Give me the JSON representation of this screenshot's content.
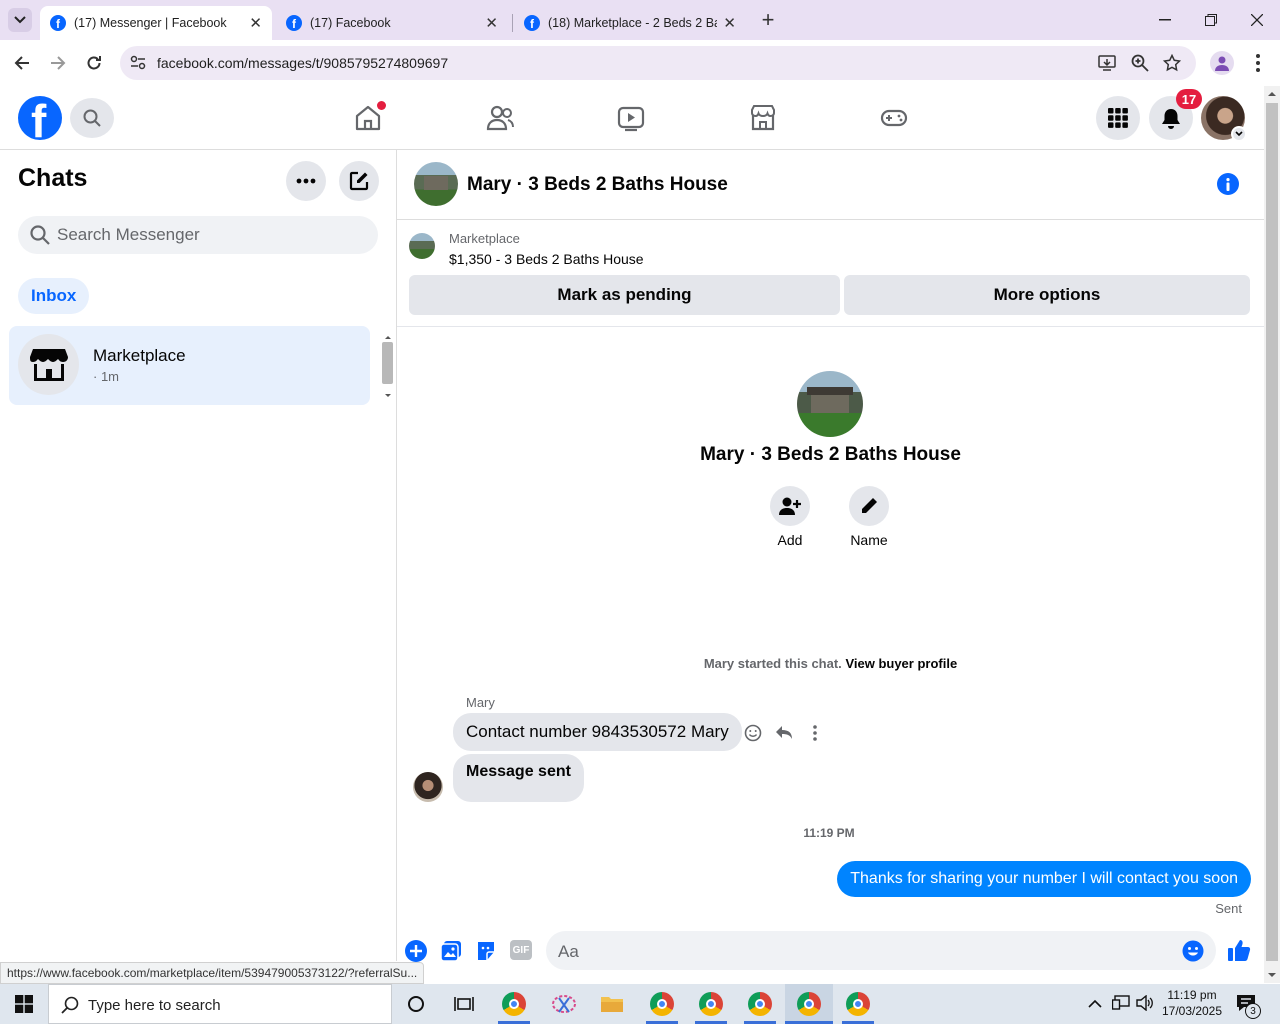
{
  "browser": {
    "tabs": [
      {
        "title": "(17) Messenger | Facebook",
        "active": true
      },
      {
        "title": "(17) Facebook",
        "active": false
      },
      {
        "title": "(18) Marketplace - 2 Beds 2 Bat",
        "active": false
      }
    ],
    "new_tab_label": "+",
    "url": "facebook.com/messages/t/9085795274809697",
    "status_url": "https://www.facebook.com/marketplace/item/539479005373122/?referralSu..."
  },
  "header": {
    "notifications_count": "17",
    "logo_letter": "f"
  },
  "sidebar": {
    "title": "Chats",
    "search_placeholder": "Search Messenger",
    "filter_tab": "Inbox",
    "conversations": [
      {
        "name": "Marketplace",
        "meta": "· 1m"
      }
    ]
  },
  "chat": {
    "title": "Mary · 3 Beds 2 Baths House",
    "listing": {
      "source": "Marketplace",
      "price_title": "$1,350 - 3 Beds 2 Baths House"
    },
    "mark_pending_label": "Mark as pending",
    "more_options_label": "More options",
    "intro_title": "Mary · 3 Beds 2 Baths House",
    "add_label": "Add",
    "name_label": "Name",
    "started_text": "Mary started this chat.",
    "view_profile_link": "View buyer profile",
    "sender_name": "Mary",
    "messages_in": [
      "Contact number 9843530572 Mary",
      "Message sent"
    ],
    "timestamp": "11:19 PM",
    "message_out": "Thanks for sharing your number I will contact you soon",
    "sent_status": "Sent",
    "composer_placeholder": "Aa",
    "gif_label": "GIF"
  },
  "taskbar": {
    "search_placeholder": "Type here to search",
    "time": "11:19 pm",
    "date": "17/03/2025",
    "notification_count": "3"
  },
  "colors": {
    "fb_blue": "#0866ff",
    "messenger_blue": "#0084ff",
    "badge_red": "#e41e3f"
  }
}
